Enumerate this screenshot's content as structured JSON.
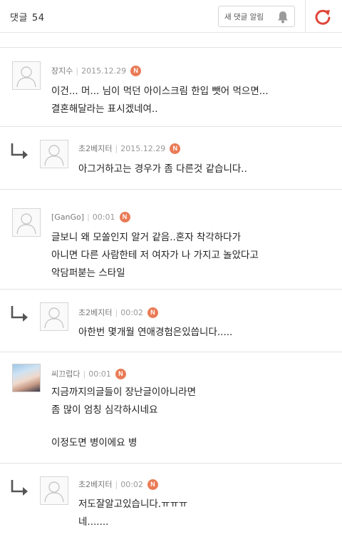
{
  "header": {
    "title": "댓글",
    "count": "54",
    "notify_label": "새 댓글 알림"
  },
  "comments": [
    {
      "author": "장지수",
      "date": "2015.12.29",
      "badge": "N",
      "lines": [
        "이건... 머... 님이 먹던 아이스크림 한입 뺏어 먹으면...",
        "결혼해달라는 표시겠네여.."
      ]
    },
    {
      "author": "초2베지터",
      "date": "2015.12.29",
      "badge": "N",
      "lines": [
        "아그거하고는 경우가 좀 다른것 같습니다.."
      ]
    },
    {
      "author": "[GanGo]",
      "date": "00:01",
      "badge": "N",
      "lines": [
        "글보니 왜 모쏠인지 알거 같음..혼자 착각하다가",
        "아니면 다른 사람한테 저 여자가 나 가지고 놀았다고",
        "악담퍼붇는 스타일"
      ]
    },
    {
      "author": "초2베지터",
      "date": "00:02",
      "badge": "N",
      "lines": [
        "아한번 몇개월 연애경험은있씁니다....."
      ]
    },
    {
      "author": "씨끄럽다",
      "date": "00:01",
      "badge": "N",
      "lines": [
        "지금까지의글들이 장난글이아니라면",
        "좀 많이 엄칭 심각하시네요",
        "",
        "이정도면 병이에요 병"
      ]
    },
    {
      "author": "초2베지터",
      "date": "00:02",
      "badge": "N",
      "lines": [
        "저도잘알고있습니다.ㅠㅠㅠ",
        "네......."
      ]
    }
  ],
  "colors": {
    "accent_red": "#e0463a",
    "badge_orange": "#e97b56",
    "divider": "#e2e2e2"
  },
  "icons": {
    "bell": "bell-icon",
    "refresh": "refresh-icon",
    "reply": "reply-arrow-icon",
    "avatar": "default-avatar-icon"
  }
}
